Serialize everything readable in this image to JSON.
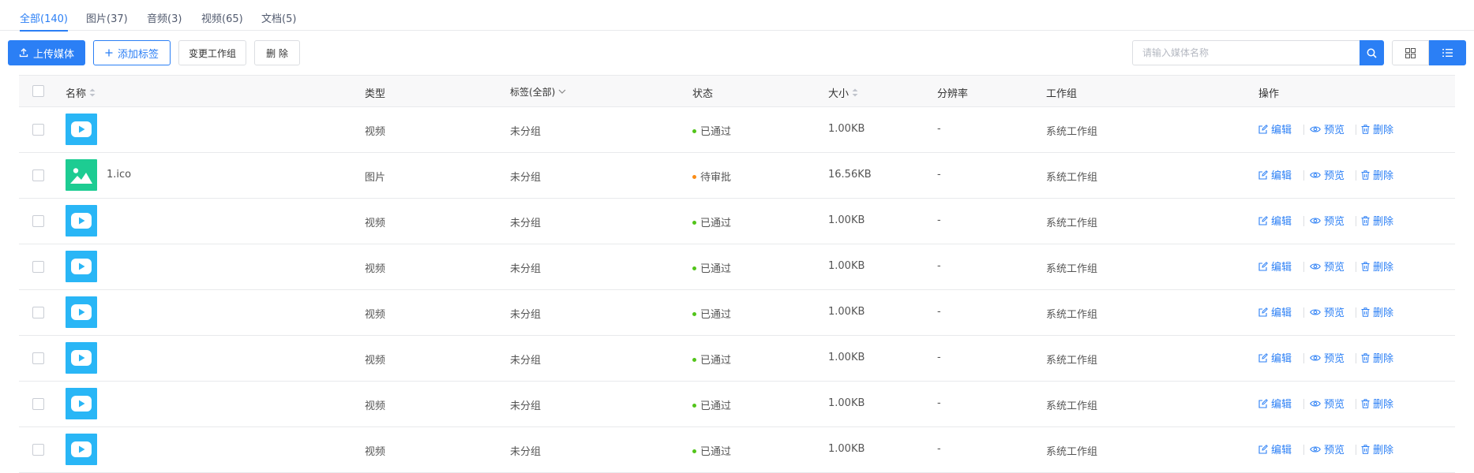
{
  "tabs": [
    {
      "label": "全部(140)",
      "active": true
    },
    {
      "label": "图片(37)",
      "active": false
    },
    {
      "label": "音频(3)",
      "active": false
    },
    {
      "label": "视频(65)",
      "active": false
    },
    {
      "label": "文档(5)",
      "active": false
    }
  ],
  "toolbar": {
    "upload_label": "上传媒体",
    "add_tag_label": "添加标签",
    "change_group_label": "变更工作组",
    "delete_label": "删 除",
    "search_placeholder": "请输入媒体名称"
  },
  "table": {
    "columns": {
      "name": "名称",
      "type": "类型",
      "tag": "标签(全部)",
      "status": "状态",
      "size": "大小",
      "resolution": "分辨率",
      "group": "工作组",
      "actions": "操作"
    },
    "actions": {
      "edit": "编辑",
      "preview": "预览",
      "delete": "删除"
    },
    "rows": [
      {
        "thumb": "video",
        "name": "",
        "type": "视频",
        "tag": "未分组",
        "status": "已通过",
        "status_color": "#52c41a",
        "size": "1.00KB",
        "resolution": "-",
        "group": "系统工作组"
      },
      {
        "thumb": "image",
        "name": "1.ico",
        "type": "图片",
        "tag": "未分组",
        "status": "待审批",
        "status_color": "#fa8c16",
        "size": "16.56KB",
        "resolution": "-",
        "group": "系统工作组"
      },
      {
        "thumb": "video",
        "name": "",
        "type": "视频",
        "tag": "未分组",
        "status": "已通过",
        "status_color": "#52c41a",
        "size": "1.00KB",
        "resolution": "-",
        "group": "系统工作组"
      },
      {
        "thumb": "video",
        "name": "",
        "type": "视频",
        "tag": "未分组",
        "status": "已通过",
        "status_color": "#52c41a",
        "size": "1.00KB",
        "resolution": "-",
        "group": "系统工作组"
      },
      {
        "thumb": "video",
        "name": "",
        "type": "视频",
        "tag": "未分组",
        "status": "已通过",
        "status_color": "#52c41a",
        "size": "1.00KB",
        "resolution": "-",
        "group": "系统工作组"
      },
      {
        "thumb": "video",
        "name": "",
        "type": "视频",
        "tag": "未分组",
        "status": "已通过",
        "status_color": "#52c41a",
        "size": "1.00KB",
        "resolution": "-",
        "group": "系统工作组"
      },
      {
        "thumb": "video",
        "name": "",
        "type": "视频",
        "tag": "未分组",
        "status": "已通过",
        "status_color": "#52c41a",
        "size": "1.00KB",
        "resolution": "-",
        "group": "系统工作组"
      },
      {
        "thumb": "video",
        "name": "",
        "type": "视频",
        "tag": "未分组",
        "status": "已通过",
        "status_color": "#52c41a",
        "size": "1.00KB",
        "resolution": "-",
        "group": "系统工作组"
      }
    ]
  },
  "colors": {
    "accent": "#2b7ff5",
    "video_thumb": "#29b6f6",
    "image_thumb": "#1dcc92",
    "approved": "#52c41a",
    "pending": "#fa8c16"
  },
  "icons": {
    "upload": "upload-icon",
    "plus": "plus-icon",
    "search": "search-icon",
    "grid_view": "grid-view-icon",
    "list_view": "list-view-icon",
    "edit": "edit-icon",
    "preview": "eye-icon",
    "delete": "trash-icon",
    "sort": "sort-icon",
    "dropdown": "chevron-down-icon",
    "video": "play-icon",
    "image": "image-icon"
  }
}
